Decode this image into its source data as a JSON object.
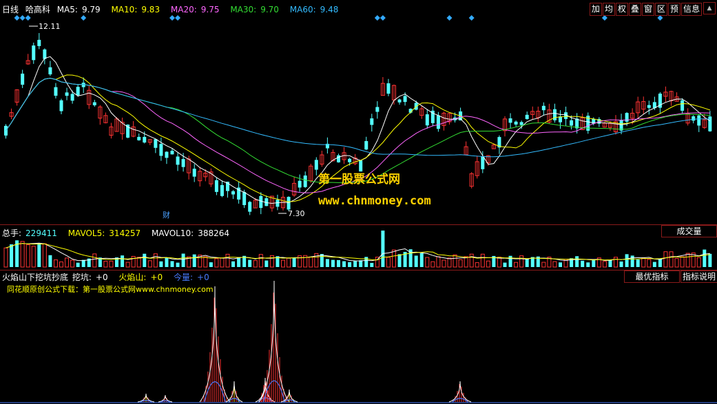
{
  "header": {
    "period": "日线",
    "stock_name": "哈高科",
    "ma5": {
      "label": "MA5:",
      "value": "9.79",
      "color": "#ffffff"
    },
    "ma10": {
      "label": "MA10:",
      "value": "9.83",
      "color": "#ffff00"
    },
    "ma20": {
      "label": "MA20:",
      "value": "9.75",
      "color": "#ff66ff"
    },
    "ma30": {
      "label": "MA30:",
      "value": "9.70",
      "color": "#33dd33"
    },
    "ma60": {
      "label": "MA60:",
      "value": "9.48",
      "color": "#33bbff"
    }
  },
  "toolbar": [
    "加",
    "均",
    "权",
    "叠",
    "窗",
    "区",
    "预",
    "信息"
  ],
  "price_chart": {
    "high_label": "12.11",
    "low_label": "7.30",
    "finance_mark": "财",
    "watermark_name": "第一股票公式网",
    "watermark_url": "www.chnmoney.com"
  },
  "volume_panel": {
    "total_label": "总手:",
    "total_value": "229411",
    "mavol5_label": "MAVOL5:",
    "mavol5_value": "314257",
    "mavol10_label": "MAVOL10:",
    "mavol10_value": "388264",
    "tab_label": "成交量"
  },
  "indicator_panel": {
    "name": "火焰山下挖坑抄底",
    "wk_label": "挖坑:",
    "wk_value": "+0",
    "hys_label": "火焰山:",
    "hys_value": "+0",
    "jl_label": "今量:",
    "jl_value": "+0",
    "source_line": "同花顺原创公式下载：第一股票公式网www.chnmoney.com",
    "tab_best": "最优指标",
    "tab_help": "指标说明"
  },
  "colors": {
    "up": "#ff3333",
    "down": "#54ffff",
    "border": "#8a1a1a",
    "signal": "#33aaff"
  }
}
